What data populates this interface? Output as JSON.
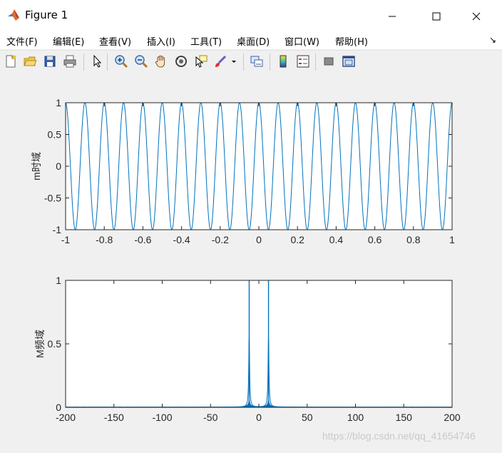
{
  "window": {
    "title": "Figure 1",
    "controls": [
      "minimize",
      "maximize",
      "close"
    ]
  },
  "menubar": {
    "items": [
      "文件(F)",
      "编辑(E)",
      "查看(V)",
      "插入(I)",
      "工具(T)",
      "桌面(D)",
      "窗口(W)",
      "帮助(H)"
    ]
  },
  "toolbar": {
    "buttons": [
      "new-figure-icon",
      "open-file-icon",
      "save-icon",
      "print-icon",
      "edit-plot-arrow-icon",
      "zoom-in-icon",
      "zoom-out-icon",
      "pan-hand-icon",
      "rotate-3d-icon",
      "data-cursor-icon",
      "brush-icon",
      "brush-dropdown-icon",
      "link-plot-icon",
      "insert-colorbar-icon",
      "insert-legend-icon",
      "hide-plot-tools-icon",
      "show-plot-tools-icon"
    ]
  },
  "watermark": "https://blog.csdn.net/qq_41654746",
  "chart_data": [
    {
      "type": "line",
      "title": "",
      "xlabel": "",
      "ylabel": "m时域",
      "xlim": [
        -1,
        1
      ],
      "ylim": [
        -1,
        1
      ],
      "xticks": [
        "-1",
        "-0.8",
        "-0.6",
        "-0.4",
        "-0.2",
        "0",
        "0.2",
        "0.4",
        "0.6",
        "0.8",
        "1"
      ],
      "yticks": [
        "-1",
        "-0.5",
        "0",
        "0.5",
        "1"
      ],
      "series": [
        {
          "function": "cos(2*pi*10*t)",
          "frequency": 10,
          "amplitude": 1,
          "color": "#0072bd"
        }
      ],
      "grid": false
    },
    {
      "type": "line",
      "title": "",
      "xlabel": "",
      "ylabel": "M频域",
      "xlim": [
        -200,
        200
      ],
      "ylim": [
        0,
        1
      ],
      "xticks": [
        "-200",
        "-150",
        "-100",
        "-50",
        "0",
        "50",
        "100",
        "150",
        "200"
      ],
      "yticks": [
        "0",
        "0.5",
        "1"
      ],
      "series": [
        {
          "peaks": [
            -10,
            10
          ],
          "peak_value": 1,
          "color": "#0072bd"
        }
      ],
      "grid": false
    }
  ]
}
